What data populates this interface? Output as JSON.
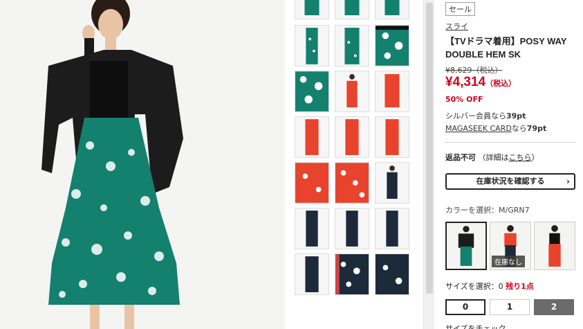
{
  "product": {
    "sale_badge": "セール",
    "brand": "スライ",
    "title": "【TVドラマ着用】POSY WAY DOUBLE HEM SK",
    "original_price": "¥8,629（税込）",
    "price": "¥4,314",
    "price_tax": "（税込）",
    "discount": "50% OFF",
    "points_silver_prefix": "シルバー会員なら",
    "points_silver_value": "39pt",
    "points_card_link": "MAGASEEK CARD",
    "points_card_mid": "なら",
    "points_card_value": "79pt",
    "returns_label": "返品不可",
    "returns_detail_prefix": "（詳細は",
    "returns_detail_link": "こちら",
    "returns_detail_suffix": "）",
    "stock_button": "在庫状況を確認する",
    "color_label": "カラーを選択：",
    "color_value": "M/GRN7",
    "out_of_stock": "在庫なし",
    "size_label": "サイズを選択：",
    "size_value": "0",
    "size_remaining": "残り1点",
    "sizes": [
      "0",
      "1",
      "2"
    ],
    "size_check": "サイズをチェック"
  },
  "colors": {
    "accent_red": "#d0021b",
    "green_skirt": "#14806e",
    "red_skirt": "#e8432d",
    "navy_skirt": "#1d2a3a"
  }
}
